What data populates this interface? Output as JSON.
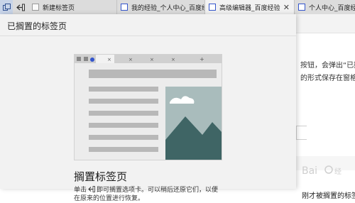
{
  "tabs": {
    "items": [
      {
        "label": "新建标签页"
      },
      {
        "label": "我的经验_个人中心_百度经验"
      },
      {
        "label": "高级编辑器_百度经验"
      },
      {
        "label": "个人中心_百度经验"
      }
    ]
  },
  "panel": {
    "title": "已搁置的标签页",
    "empty_title": "搁置标签页",
    "empty_desc_before": "单击",
    "empty_desc_after": "即可搁置选项卡。可以稍后还原它们，以便在原来的位置进行恢复。"
  },
  "page": {
    "line1": "按钮，会弹出“已搁",
    "line2": "的形式保存在窗格中",
    "line3": "刚才被搁置的标签"
  },
  "watermark": "Bai 经验",
  "colors": {
    "accent": "#3355cc",
    "illustration_teal": "#3f6565",
    "illustration_sky": "#a9bcbc"
  }
}
